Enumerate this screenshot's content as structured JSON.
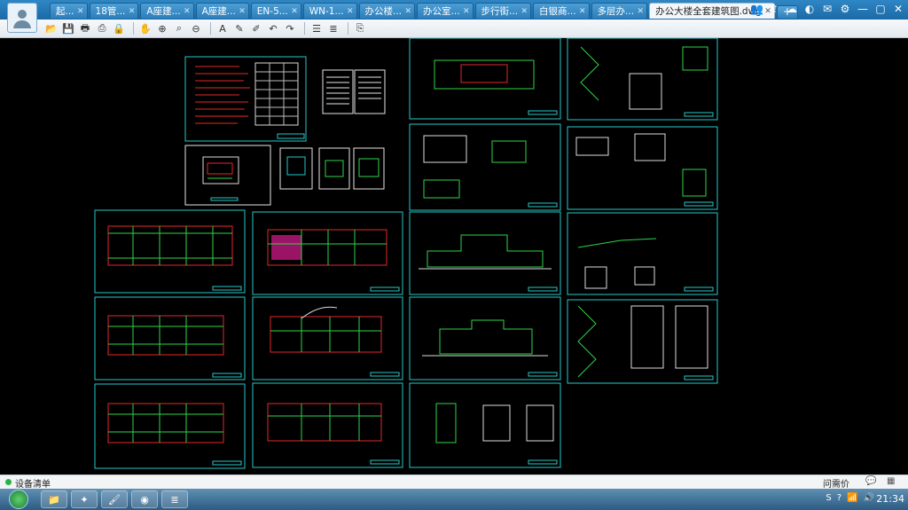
{
  "tabs": [
    {
      "label": "起..."
    },
    {
      "label": "18管..."
    },
    {
      "label": "A座建..."
    },
    {
      "label": "A座建..."
    },
    {
      "label": "EN-5..."
    },
    {
      "label": "WN-1..."
    },
    {
      "label": "办公楼..."
    },
    {
      "label": "办公室..."
    },
    {
      "label": "步行街..."
    },
    {
      "label": "白银商..."
    },
    {
      "label": "多层办..."
    },
    {
      "label": "办公大楼全套建筑图.dwg"
    }
  ],
  "new_tab_label": "+",
  "toolbar_icons": [
    "open-icon",
    "save-icon",
    "print-icon",
    "print-preview-icon",
    "lock-icon",
    "pan-icon",
    "zoom-in-icon",
    "zoom-window-icon",
    "zoom-out-icon",
    "text-icon",
    "pen-icon",
    "markup-icon",
    "undo-icon",
    "redo-icon",
    "layer-icon",
    "layers-stack-icon",
    "export-icon"
  ],
  "status": {
    "label": "设备清单",
    "ask": "问需价"
  },
  "clock": "21:34",
  "colors": {
    "accent": "#1b6aa6",
    "sheet_border": "#27c7c7",
    "canvas": "#000000"
  }
}
